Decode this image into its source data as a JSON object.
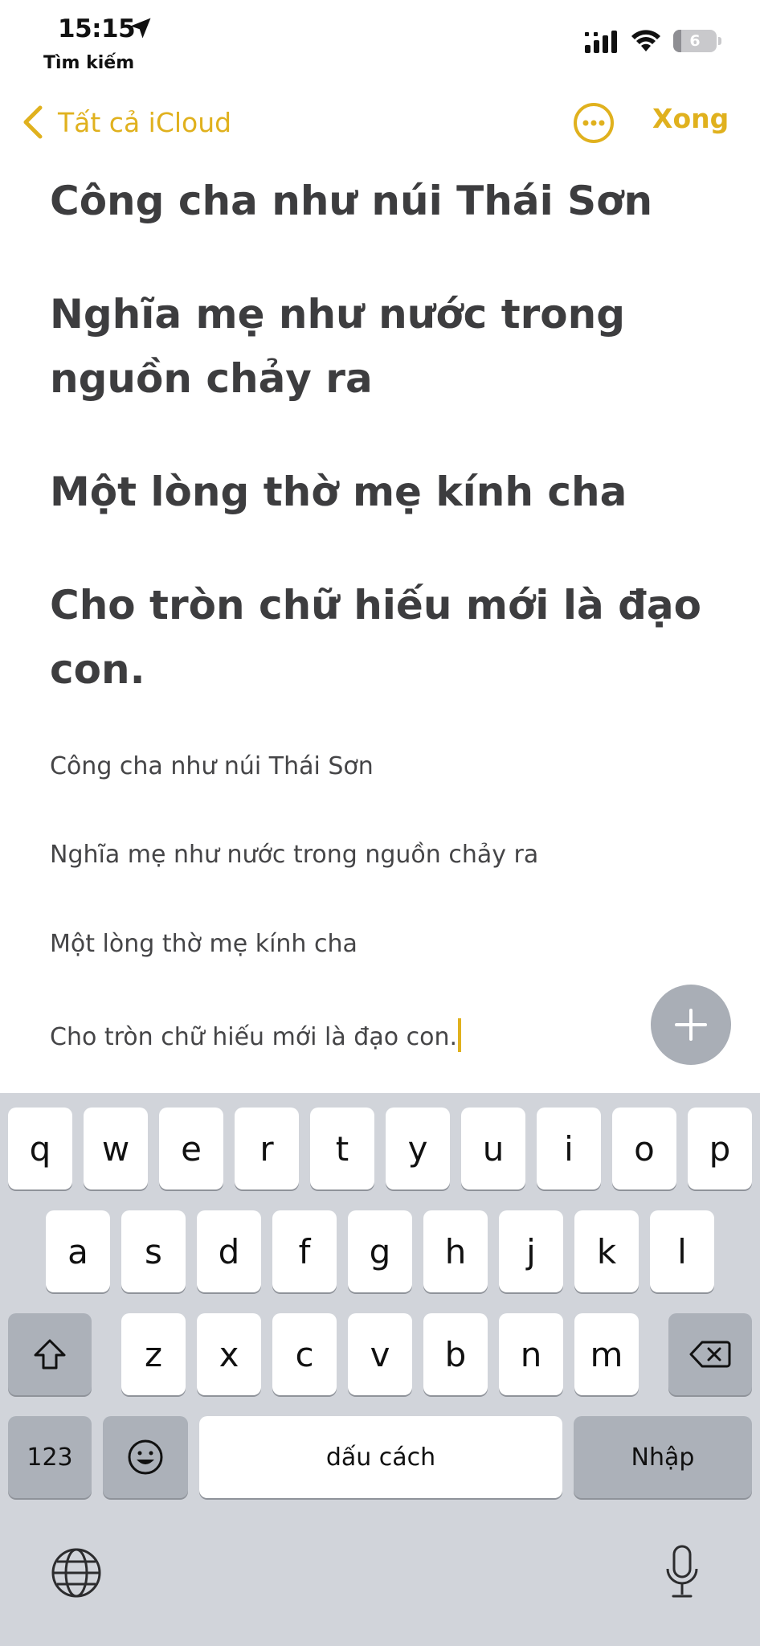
{
  "status_bar": {
    "time": "15:15",
    "back_app": "Tìm kiếm",
    "battery_level": "6"
  },
  "nav": {
    "back_label": "Tất cả iCloud",
    "done_label": "Xong",
    "accent_color": "#e0b11e"
  },
  "note": {
    "headings": [
      "Công cha như núi Thái Sơn",
      "Nghĩa mẹ như nước trong nguồn chảy ra",
      "Một lòng thờ mẹ kính cha",
      "Cho tròn chữ hiếu mới là đạo con."
    ],
    "body_lines": [
      "Công cha như núi Thái Sơn",
      "Nghĩa mẹ như nước trong nguồn chảy ra",
      "Một lòng thờ mẹ kính cha",
      "Cho tròn chữ hiếu mới là đạo con."
    ]
  },
  "keyboard": {
    "row1": [
      "q",
      "w",
      "e",
      "r",
      "t",
      "y",
      "u",
      "i",
      "o",
      "p"
    ],
    "row2": [
      "a",
      "s",
      "d",
      "f",
      "g",
      "h",
      "j",
      "k",
      "l"
    ],
    "row3": [
      "z",
      "x",
      "c",
      "v",
      "b",
      "n",
      "m"
    ],
    "numbers_label": "123",
    "space_label": "dấu cách",
    "return_label": "Nhập"
  },
  "icons": {
    "location": "location-arrow-icon",
    "signal": "cellular-signal-icon",
    "wifi": "wifi-icon",
    "battery": "battery-icon",
    "back": "chevron-left-icon",
    "more": "ellipsis-circle-icon",
    "add": "plus-icon",
    "shift": "shift-icon",
    "delete": "backspace-icon",
    "emoji": "emoji-icon",
    "globe": "globe-icon",
    "mic": "microphone-icon"
  }
}
